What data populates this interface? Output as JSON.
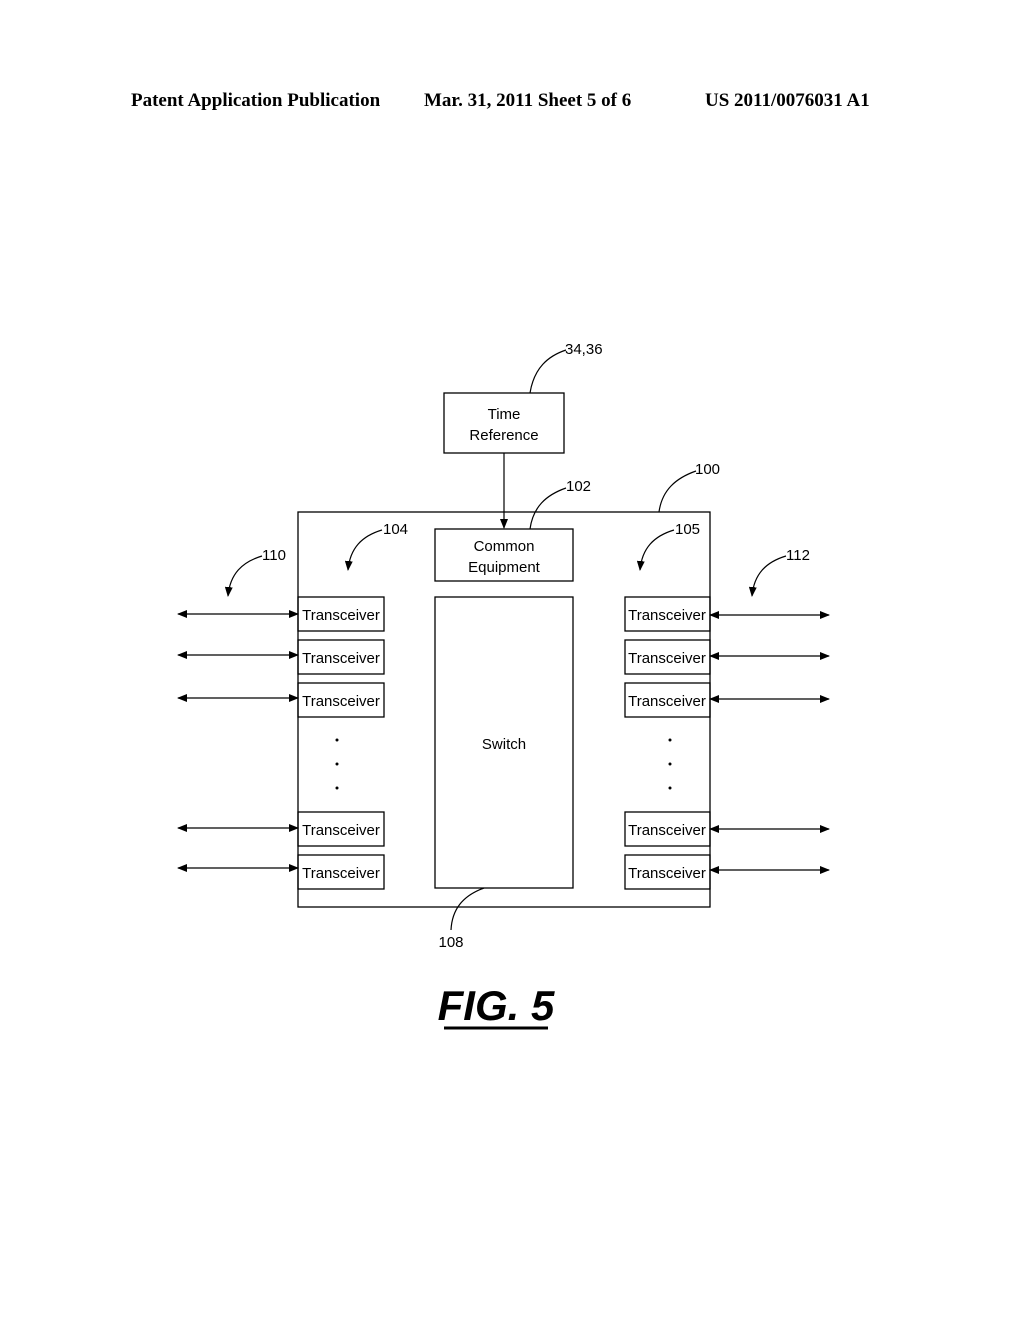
{
  "header": {
    "publication": "Patent Application Publication",
    "date_sheet": "Mar. 31, 2011  Sheet 5 of 6",
    "number": "US 2011/0076031 A1"
  },
  "diagram": {
    "time_reference": {
      "line1": "Time",
      "line2": "Reference",
      "ref": "34,36"
    },
    "common_equipment": {
      "line1": "Common",
      "line2": "Equipment",
      "ref": "102"
    },
    "switch": {
      "label": "Switch",
      "ref": "108"
    },
    "outer_box": {
      "ref": "100"
    },
    "left_group": {
      "ref": "104",
      "link_ref": "110",
      "transceiver_label": "Transceiver"
    },
    "right_group": {
      "ref": "105",
      "link_ref": "112",
      "transceiver_label": "Transceiver"
    },
    "ellipsis": "·"
  },
  "figure": {
    "caption": "FIG. 5"
  }
}
